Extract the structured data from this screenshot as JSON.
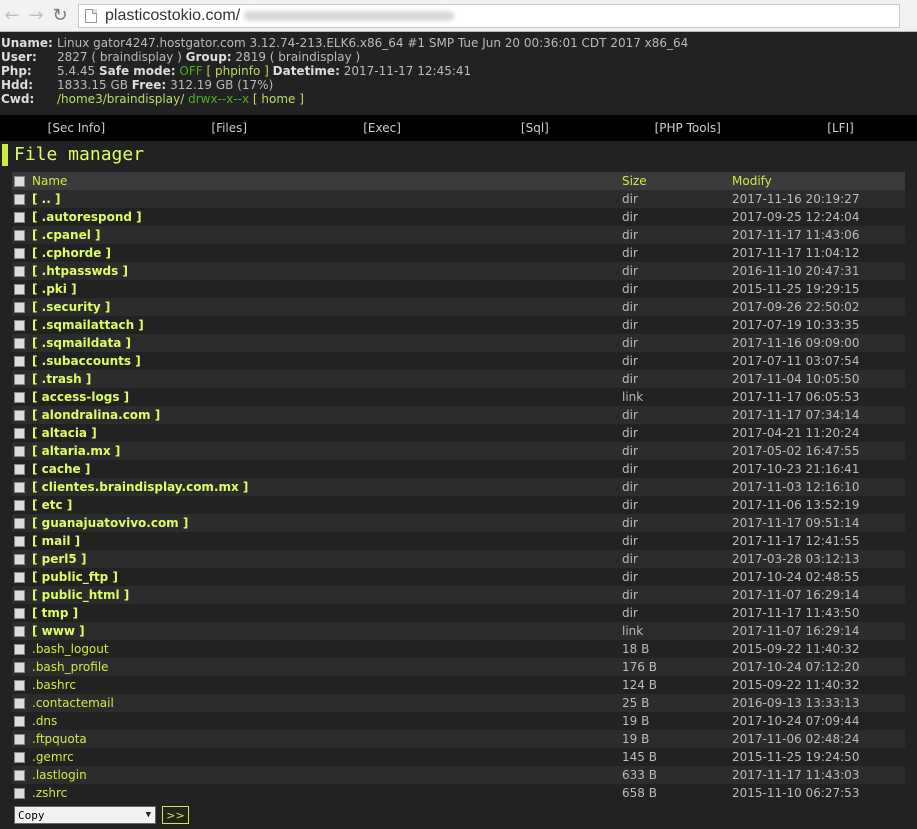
{
  "browser": {
    "back_icon": "arrow-left-icon",
    "forward_icon": "arrow-right-icon",
    "reload_icon": "reload-icon",
    "url": "plasticostokio.com/"
  },
  "sysinfo": {
    "uname_label": "Uname:",
    "uname": "Linux gator4247.hostgator.com 3.12.74-213.ELK6.x86_64 #1 SMP Tue Jun 20 00:36:01 CDT 2017 x86_64",
    "user_label": "User:",
    "user": "2827 ( braindisplay )",
    "group_label": "Group:",
    "group": "2819 ( braindisplay )",
    "php_label": "Php:",
    "php": "5.4.45",
    "safe_mode_label": "Safe mode:",
    "safe_mode": "OFF",
    "phpinfo": "[ phpinfo ]",
    "datetime_label": "Datetime:",
    "datetime": "2017-11-17 12:45:41",
    "hdd_label": "Hdd:",
    "hdd": "1833.15 GB",
    "free_label": "Free:",
    "free": "312.19 GB (17%)",
    "cwd_label": "Cwd:",
    "cwd": "/home3/braindisplay/",
    "perms": "drwx--x--x",
    "home": "[ home ]"
  },
  "menu": [
    "[Sec Info]",
    "[Files]",
    "[Exec]",
    "[Sql]",
    "[PHP Tools]",
    "[LFI]"
  ],
  "section_title": "File manager",
  "table": {
    "headers": [
      "Name",
      "Size",
      "Modify"
    ],
    "rows": [
      {
        "name": "[ .. ]",
        "size": "dir",
        "modify": "2017-11-16 20:19:27",
        "dir": true
      },
      {
        "name": "[ .autorespond ]",
        "size": "dir",
        "modify": "2017-09-25 12:24:04",
        "dir": true
      },
      {
        "name": "[ .cpanel ]",
        "size": "dir",
        "modify": "2017-11-17 11:43:06",
        "dir": true
      },
      {
        "name": "[ .cphorde ]",
        "size": "dir",
        "modify": "2017-11-17 11:04:12",
        "dir": true
      },
      {
        "name": "[ .htpasswds ]",
        "size": "dir",
        "modify": "2016-11-10 20:47:31",
        "dir": true
      },
      {
        "name": "[ .pki ]",
        "size": "dir",
        "modify": "2015-11-25 19:29:15",
        "dir": true
      },
      {
        "name": "[ .security ]",
        "size": "dir",
        "modify": "2017-09-26 22:50:02",
        "dir": true
      },
      {
        "name": "[ .sqmailattach ]",
        "size": "dir",
        "modify": "2017-07-19 10:33:35",
        "dir": true
      },
      {
        "name": "[ .sqmaildata ]",
        "size": "dir",
        "modify": "2017-11-16 09:09:00",
        "dir": true
      },
      {
        "name": "[ .subaccounts ]",
        "size": "dir",
        "modify": "2017-07-11 03:07:54",
        "dir": true
      },
      {
        "name": "[ .trash ]",
        "size": "dir",
        "modify": "2017-11-04 10:05:50",
        "dir": true
      },
      {
        "name": "[ access-logs ]",
        "size": "link",
        "modify": "2017-11-17 06:05:53",
        "dir": true
      },
      {
        "name": "[ alondralina.com ]",
        "size": "dir",
        "modify": "2017-11-17 07:34:14",
        "dir": true
      },
      {
        "name": "[ altacia ]",
        "size": "dir",
        "modify": "2017-04-21 11:20:24",
        "dir": true
      },
      {
        "name": "[ altaria.mx ]",
        "size": "dir",
        "modify": "2017-05-02 16:47:55",
        "dir": true
      },
      {
        "name": "[ cache ]",
        "size": "dir",
        "modify": "2017-10-23 21:16:41",
        "dir": true
      },
      {
        "name": "[ clientes.braindisplay.com.mx ]",
        "size": "dir",
        "modify": "2017-11-03 12:16:10",
        "dir": true
      },
      {
        "name": "[ etc ]",
        "size": "dir",
        "modify": "2017-11-06 13:52:19",
        "dir": true
      },
      {
        "name": "[ guanajuatovivo.com ]",
        "size": "dir",
        "modify": "2017-11-17 09:51:14",
        "dir": true
      },
      {
        "name": "[ mail ]",
        "size": "dir",
        "modify": "2017-11-17 12:41:55",
        "dir": true
      },
      {
        "name": "[ perl5 ]",
        "size": "dir",
        "modify": "2017-03-28 03:12:13",
        "dir": true
      },
      {
        "name": "[ public_ftp ]",
        "size": "dir",
        "modify": "2017-10-24 02:48:55",
        "dir": true
      },
      {
        "name": "[ public_html ]",
        "size": "dir",
        "modify": "2017-11-07 16:29:14",
        "dir": true
      },
      {
        "name": "[ tmp ]",
        "size": "dir",
        "modify": "2017-11-17 11:43:50",
        "dir": true
      },
      {
        "name": "[ www ]",
        "size": "link",
        "modify": "2017-11-07 16:29:14",
        "dir": true
      },
      {
        "name": ".bash_logout",
        "size": "18 B",
        "modify": "2015-09-22 11:40:32",
        "dir": false
      },
      {
        "name": ".bash_profile",
        "size": "176 B",
        "modify": "2017-10-24 07:12:20",
        "dir": false
      },
      {
        "name": ".bashrc",
        "size": "124 B",
        "modify": "2015-09-22 11:40:32",
        "dir": false
      },
      {
        "name": ".contactemail",
        "size": "25 B",
        "modify": "2016-09-13 13:33:13",
        "dir": false
      },
      {
        "name": ".dns",
        "size": "19 B",
        "modify": "2017-10-24 07:09:44",
        "dir": false
      },
      {
        "name": ".ftpquota",
        "size": "19 B",
        "modify": "2017-11-06 02:48:24",
        "dir": false
      },
      {
        "name": ".gemrc",
        "size": "145 B",
        "modify": "2015-11-25 19:24:50",
        "dir": false
      },
      {
        "name": ".lastlogin",
        "size": "633 B",
        "modify": "2017-11-17 11:43:03",
        "dir": false
      },
      {
        "name": ".zshrc",
        "size": "658 B",
        "modify": "2015-11-10 06:27:53",
        "dir": false
      }
    ]
  },
  "actions": {
    "selected": "Copy",
    "go_label": ">>"
  }
}
